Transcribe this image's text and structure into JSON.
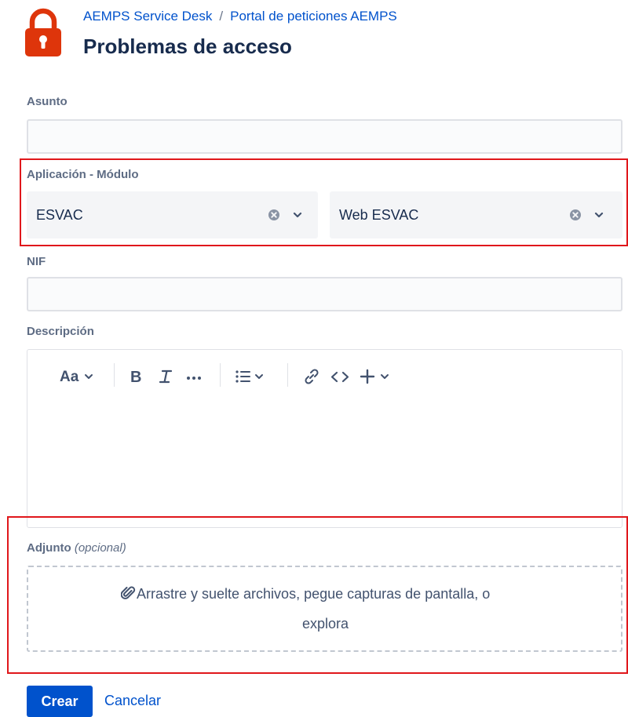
{
  "header": {
    "breadcrumb": [
      "AEMPS Service Desk",
      "Portal de peticiones AEMPS"
    ],
    "breadcrumb_separator": "/",
    "title": "Problemas de acceso",
    "icon": "lock-icon"
  },
  "form": {
    "asunto": {
      "label": "Asunto",
      "value": ""
    },
    "aplicacion": {
      "label": "Aplicación - Módulo",
      "application_value": "ESVAC",
      "module_value": "Web ESVAC"
    },
    "nif": {
      "label": "NIF",
      "value": ""
    },
    "descripcion": {
      "label": "Descripción",
      "toolbar": [
        "text-style",
        "bold",
        "italic",
        "more-formatting",
        "list",
        "link",
        "code",
        "insert"
      ],
      "value": ""
    },
    "adjunto": {
      "label": "Adjunto",
      "optional": "(opcional)",
      "drop_text": "Arrastre y suelte archivos, pegue capturas de pantalla, o",
      "browse_link": "explora"
    }
  },
  "actions": {
    "create": "Crear",
    "cancel": "Cancelar"
  },
  "colors": {
    "accent": "#0052cc",
    "lock": "#de350b",
    "highlight": "#e0171b"
  }
}
